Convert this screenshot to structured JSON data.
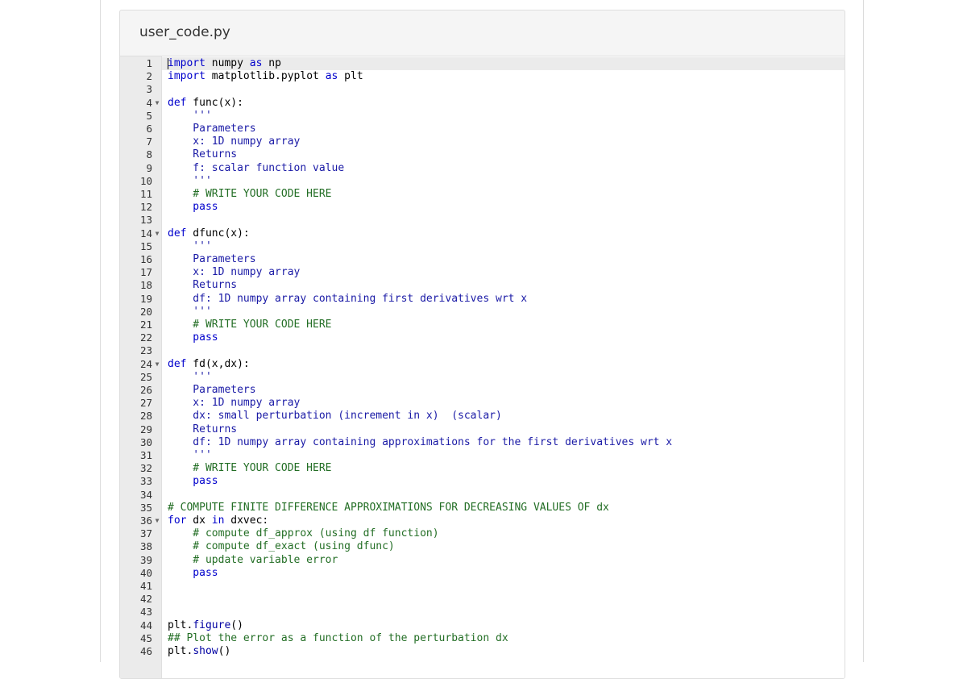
{
  "file": {
    "title": "user_code.py"
  },
  "colors": {
    "keyword": "#0000cc",
    "string": "#1a1aa6",
    "comment": "#236e25",
    "gutter_bg": "#ebebeb",
    "active_line_bg": "#ebebeb"
  },
  "editor": {
    "active_line": 1,
    "lines": [
      {
        "n": "1",
        "fold": "",
        "tokens": [
          [
            "kw",
            "import"
          ],
          [
            "id",
            " numpy "
          ],
          [
            "kw",
            "as"
          ],
          [
            "id",
            " np"
          ]
        ]
      },
      {
        "n": "2",
        "fold": "",
        "tokens": [
          [
            "kw",
            "import"
          ],
          [
            "id",
            " matplotlib.pyplot "
          ],
          [
            "kw",
            "as"
          ],
          [
            "id",
            " plt"
          ]
        ]
      },
      {
        "n": "3",
        "fold": "",
        "tokens": []
      },
      {
        "n": "4",
        "fold": "▼",
        "tokens": [
          [
            "kw",
            "def"
          ],
          [
            "id",
            " func(x):"
          ]
        ]
      },
      {
        "n": "5",
        "fold": "",
        "tokens": [
          [
            "str",
            "    '''"
          ]
        ]
      },
      {
        "n": "6",
        "fold": "",
        "tokens": [
          [
            "str",
            "    Parameters"
          ]
        ]
      },
      {
        "n": "7",
        "fold": "",
        "tokens": [
          [
            "str",
            "    x: 1D numpy array"
          ]
        ]
      },
      {
        "n": "8",
        "fold": "",
        "tokens": [
          [
            "str",
            "    Returns"
          ]
        ]
      },
      {
        "n": "9",
        "fold": "",
        "tokens": [
          [
            "str",
            "    f: scalar function value"
          ]
        ]
      },
      {
        "n": "10",
        "fold": "",
        "tokens": [
          [
            "str",
            "    '''"
          ]
        ]
      },
      {
        "n": "11",
        "fold": "",
        "tokens": [
          [
            "com",
            "    # WRITE YOUR CODE HERE"
          ]
        ]
      },
      {
        "n": "12",
        "fold": "",
        "tokens": [
          [
            "kw",
            "    pass"
          ]
        ]
      },
      {
        "n": "13",
        "fold": "",
        "tokens": []
      },
      {
        "n": "14",
        "fold": "▼",
        "tokens": [
          [
            "kw",
            "def"
          ],
          [
            "id",
            " dfunc(x):"
          ]
        ]
      },
      {
        "n": "15",
        "fold": "",
        "tokens": [
          [
            "str",
            "    '''"
          ]
        ]
      },
      {
        "n": "16",
        "fold": "",
        "tokens": [
          [
            "str",
            "    Parameters"
          ]
        ]
      },
      {
        "n": "17",
        "fold": "",
        "tokens": [
          [
            "str",
            "    x: 1D numpy array"
          ]
        ]
      },
      {
        "n": "18",
        "fold": "",
        "tokens": [
          [
            "str",
            "    Returns"
          ]
        ]
      },
      {
        "n": "19",
        "fold": "",
        "tokens": [
          [
            "str",
            "    df: 1D numpy array containing first derivatives wrt x"
          ]
        ]
      },
      {
        "n": "20",
        "fold": "",
        "tokens": [
          [
            "str",
            "    '''"
          ]
        ]
      },
      {
        "n": "21",
        "fold": "",
        "tokens": [
          [
            "com",
            "    # WRITE YOUR CODE HERE"
          ]
        ]
      },
      {
        "n": "22",
        "fold": "",
        "tokens": [
          [
            "kw",
            "    pass"
          ]
        ]
      },
      {
        "n": "23",
        "fold": "",
        "tokens": []
      },
      {
        "n": "24",
        "fold": "▼",
        "tokens": [
          [
            "kw",
            "def"
          ],
          [
            "id",
            " fd(x,dx):"
          ]
        ]
      },
      {
        "n": "25",
        "fold": "",
        "tokens": [
          [
            "str",
            "    '''"
          ]
        ]
      },
      {
        "n": "26",
        "fold": "",
        "tokens": [
          [
            "str",
            "    Parameters"
          ]
        ]
      },
      {
        "n": "27",
        "fold": "",
        "tokens": [
          [
            "str",
            "    x: 1D numpy array"
          ]
        ]
      },
      {
        "n": "28",
        "fold": "",
        "tokens": [
          [
            "str",
            "    dx: small perturbation (increment in x)  (scalar)"
          ]
        ]
      },
      {
        "n": "29",
        "fold": "",
        "tokens": [
          [
            "str",
            "    Returns"
          ]
        ]
      },
      {
        "n": "30",
        "fold": "",
        "tokens": [
          [
            "str",
            "    df: 1D numpy array containing approximations for the first derivatives wrt x"
          ]
        ]
      },
      {
        "n": "31",
        "fold": "",
        "tokens": [
          [
            "str",
            "    '''"
          ]
        ]
      },
      {
        "n": "32",
        "fold": "",
        "tokens": [
          [
            "com",
            "    # WRITE YOUR CODE HERE"
          ]
        ]
      },
      {
        "n": "33",
        "fold": "",
        "tokens": [
          [
            "kw",
            "    pass"
          ]
        ]
      },
      {
        "n": "34",
        "fold": "",
        "tokens": []
      },
      {
        "n": "35",
        "fold": "",
        "tokens": [
          [
            "com",
            "# COMPUTE FINITE DIFFERENCE APPROXIMATIONS FOR DECREASING VALUES OF dx"
          ]
        ]
      },
      {
        "n": "36",
        "fold": "▼",
        "tokens": [
          [
            "kw",
            "for"
          ],
          [
            "id",
            " dx "
          ],
          [
            "kw",
            "in"
          ],
          [
            "id",
            " dxvec:"
          ]
        ]
      },
      {
        "n": "37",
        "fold": "",
        "tokens": [
          [
            "com",
            "    # compute df_approx (using df function)"
          ]
        ]
      },
      {
        "n": "38",
        "fold": "",
        "tokens": [
          [
            "com",
            "    # compute df_exact (using dfunc)"
          ]
        ]
      },
      {
        "n": "39",
        "fold": "",
        "tokens": [
          [
            "com",
            "    # update variable error"
          ]
        ]
      },
      {
        "n": "40",
        "fold": "",
        "tokens": [
          [
            "kw",
            "    pass"
          ]
        ]
      },
      {
        "n": "41",
        "fold": "",
        "tokens": []
      },
      {
        "n": "42",
        "fold": "",
        "tokens": []
      },
      {
        "n": "43",
        "fold": "",
        "tokens": []
      },
      {
        "n": "44",
        "fold": "",
        "tokens": [
          [
            "id",
            "plt."
          ],
          [
            "fn",
            "figure"
          ],
          [
            "id",
            "()"
          ]
        ]
      },
      {
        "n": "45",
        "fold": "",
        "tokens": [
          [
            "com",
            "## Plot the error as a function of the perturbation dx"
          ]
        ]
      },
      {
        "n": "46",
        "fold": "",
        "tokens": [
          [
            "id",
            "plt."
          ],
          [
            "fn",
            "show"
          ],
          [
            "id",
            "()"
          ]
        ]
      }
    ]
  }
}
